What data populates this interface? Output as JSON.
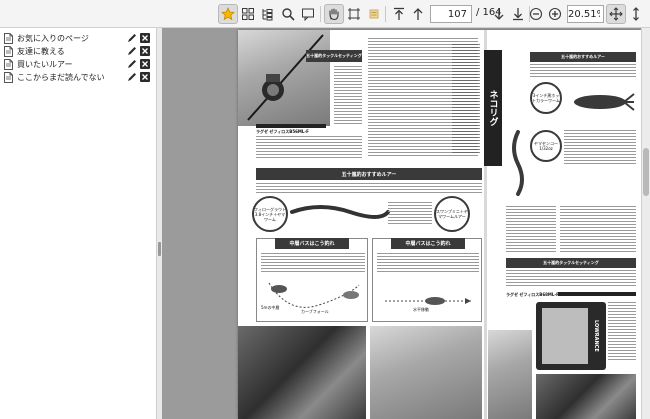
{
  "toolbar": {
    "page_current": "107",
    "page_separator_total": "/ 164",
    "zoom_value": "20.51%",
    "buttons": [
      {
        "name": "bookmarks-star-button",
        "icon": "star-icon",
        "active": true
      },
      {
        "name": "thumbnails-button",
        "icon": "grid-icon",
        "active": false
      },
      {
        "name": "outline-button",
        "icon": "outline-tree-icon",
        "active": false
      },
      {
        "name": "search-button",
        "icon": "magnifier-icon",
        "active": false
      },
      {
        "name": "comment-button",
        "icon": "speech-bubble-icon",
        "active": false
      },
      {
        "name": "hand-tool-button",
        "icon": "hand-icon",
        "active": true
      },
      {
        "name": "select-tool-button",
        "icon": "crop-frame-icon",
        "active": false
      },
      {
        "name": "highlight-button",
        "icon": "highlighter-icon",
        "active": false
      },
      {
        "name": "first-page-button",
        "icon": "arrow-up-bar-icon",
        "active": false
      },
      {
        "name": "prev-page-button",
        "icon": "arrow-up-icon",
        "active": false
      },
      {
        "name": "next-page-button",
        "icon": "arrow-down-icon",
        "active": false
      },
      {
        "name": "last-page-button",
        "icon": "arrow-down-bar-icon",
        "active": false
      },
      {
        "name": "zoom-out-button",
        "icon": "minus-circle-icon",
        "active": false
      },
      {
        "name": "zoom-in-button",
        "icon": "plus-circle-icon",
        "active": false
      },
      {
        "name": "fit-page-button",
        "icon": "move-arrows-icon",
        "active": true
      },
      {
        "name": "fit-width-button",
        "icon": "vertical-arrows-icon",
        "active": false
      }
    ]
  },
  "sidebar": {
    "bookmarks": [
      {
        "label": "お気に入りのページ"
      },
      {
        "label": "友達に教える"
      },
      {
        "label": "買いたいルアー"
      },
      {
        "label": "ここからまだ読んでない"
      }
    ]
  },
  "document": {
    "left_headline": "五十嵐的タックルセッティング",
    "left_rod_caption": "ラグゼ ゼフィロスB56ML-F",
    "middle_headline": "五十嵐的おすすめルアー",
    "lower_left_heading": "中層バスはこう釣れ",
    "lower_right_heading": "中層バスはこう釣れ",
    "mid_circle_label_left": "フィローグラウト3.8インチ＋ヤマワーム",
    "mid_circle_label_right": "スワンプミニ＋ヤマワームルアー",
    "diagram_label_fall": "カーブフォール",
    "diagram_label_depth": "5mの中層",
    "diagram_label_horizontal": "水平移動",
    "right_title": "ネコリグ",
    "right_headline": "五十嵐的おすすめルアー",
    "right_circle_label_a": "3インチ黒ホットカラーワーム",
    "right_circle_label_b": "ヤマセンコー1/32oz",
    "right_tackle_headline": "五十嵐的タックルセッティング",
    "right_rod_caption": "ラグゼ ゼフィロスB68ML-FF",
    "lowrance_label": "LOWRANCE"
  },
  "colors": {
    "toolbar_bg": "#f4f4f4",
    "viewer_bg": "#9b9b9b",
    "page_bg": "#ffffff",
    "heading_bar": "#3a3a3a",
    "active_button_bg": "#dcdcdc"
  }
}
